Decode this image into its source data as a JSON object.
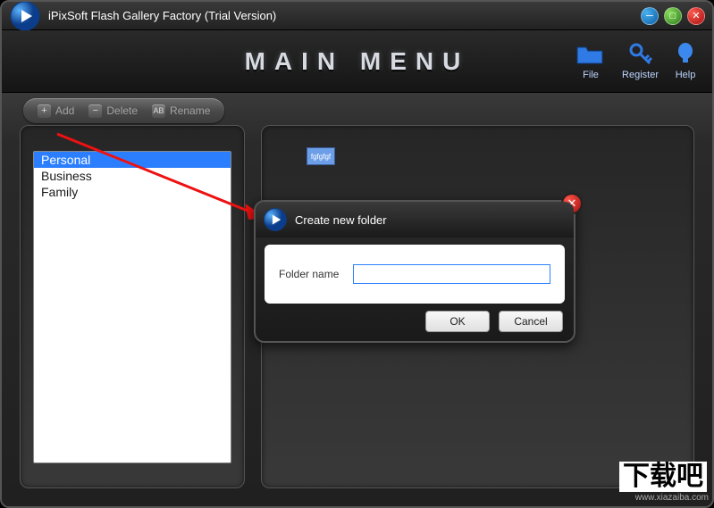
{
  "app": {
    "title": "iPixSoft Flash Gallery Factory (Trial Version)"
  },
  "header": {
    "main_title": "MAIN MENU",
    "icons": {
      "file": "File",
      "register": "Register",
      "help": "Help"
    }
  },
  "toolbar": {
    "add": "Add",
    "delete": "Delete",
    "rename": "Rename"
  },
  "sidebar": {
    "items": [
      {
        "label": "Personal",
        "selected": true
      },
      {
        "label": "Business",
        "selected": false
      },
      {
        "label": "Family",
        "selected": false
      }
    ]
  },
  "gallery": {
    "thumb_label": "fgfgfgf"
  },
  "dialog": {
    "title": "Create new folder",
    "label": "Folder name",
    "value": "",
    "ok": "OK",
    "cancel": "Cancel"
  },
  "watermark": {
    "cn": "下载吧",
    "url": "www.xiazaiba.com"
  }
}
